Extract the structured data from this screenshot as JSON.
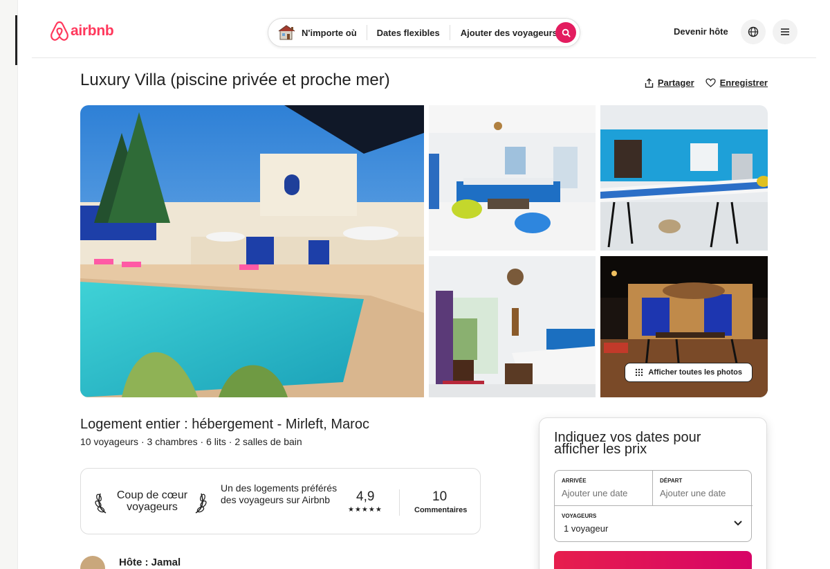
{
  "header": {
    "brand": "airbnb",
    "search": {
      "where": "N'importe où",
      "when": "Dates flexibles",
      "who": "Ajouter des voyageurs"
    },
    "host_link": "Devenir hôte",
    "icons": [
      "airbnb-logo-icon",
      "house-icon",
      "search-icon",
      "globe-icon",
      "menu-icon"
    ],
    "accent_color": "#ff385c"
  },
  "listing": {
    "title": "Luxury Villa (piscine privée et proche mer)",
    "share_label": "Partager",
    "save_label": "Enregistrer",
    "show_all_photos": "Afficher toutes les photos",
    "subtitle": "Logement entier : hébergement - Mirleft, Maroc",
    "details": [
      "10 voyageurs",
      "3 chambres",
      "6 lits",
      "2 salles de bain"
    ]
  },
  "guest_favorite": {
    "title": "Coup de cœur voyageurs",
    "description": "Un des logements préférés des voyageurs sur Airbnb",
    "rating": "4,9",
    "stars": "★★★★★",
    "reviews_count": "10",
    "reviews_label": "Commentaires"
  },
  "host": {
    "label": "Hôte : Jamal"
  },
  "booking": {
    "title": "Indiquez vos dates pour afficher les prix",
    "checkin_label": "ARRIVÉE",
    "checkin_value": "Ajouter une date",
    "checkout_label": "DÉPART",
    "checkout_value": "Ajouter une date",
    "guests_label": "VOYAGEURS",
    "guests_value": "1 voyageur",
    "button_color": "#e61e4d"
  }
}
